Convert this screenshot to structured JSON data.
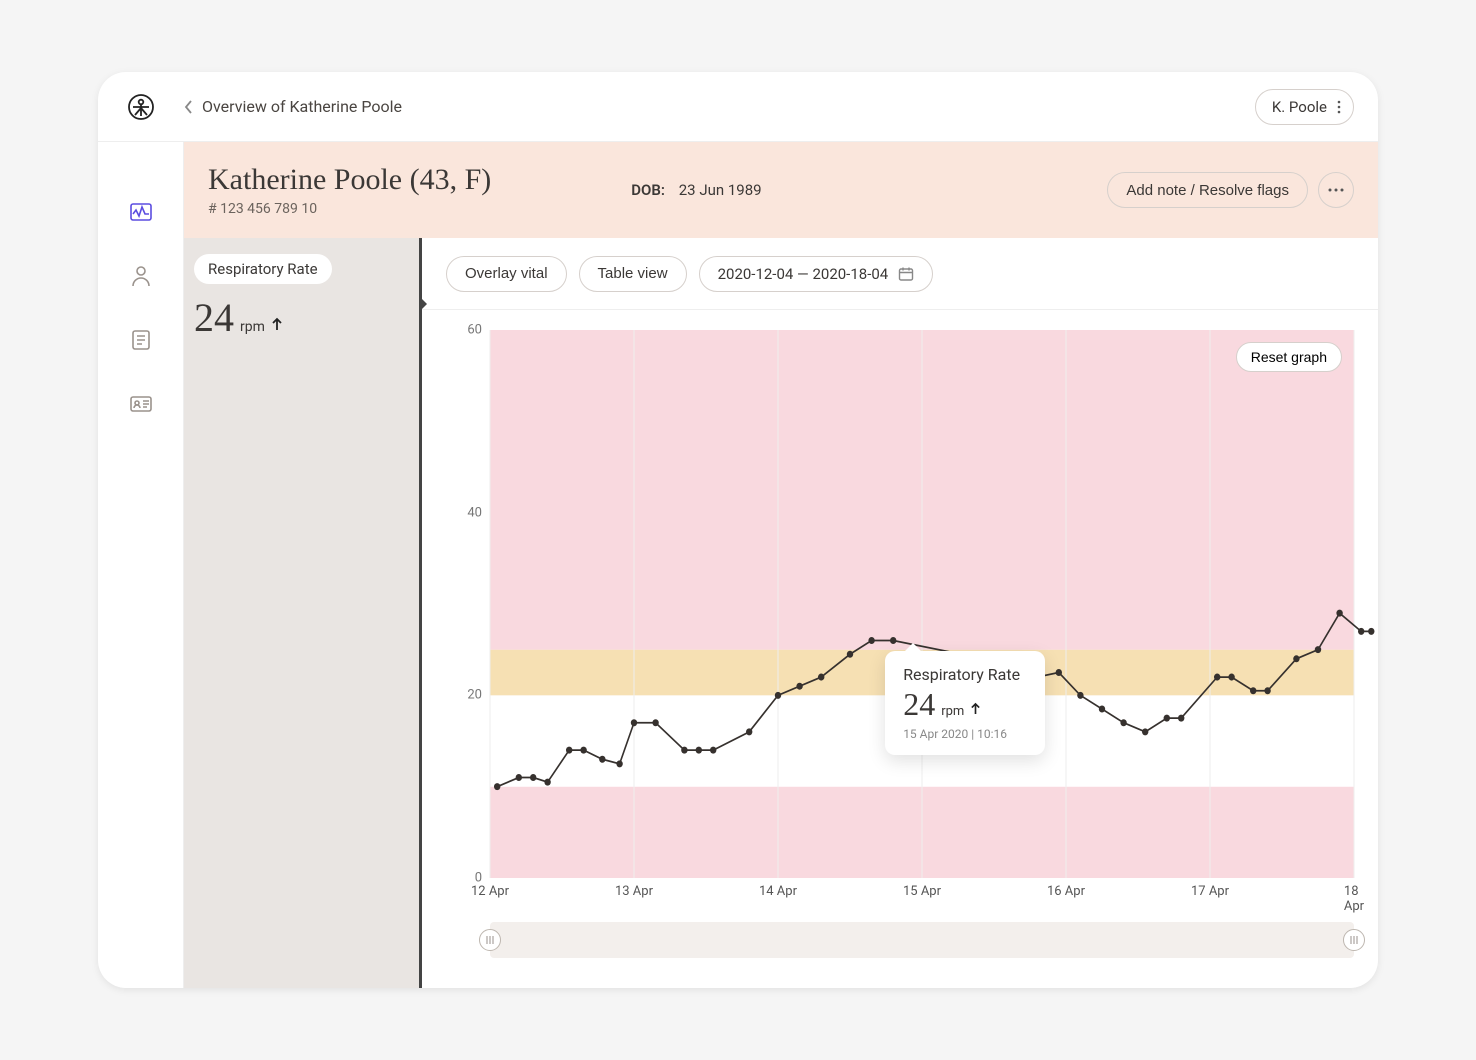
{
  "topbar": {
    "breadcrumb": "Overview of Katherine Poole",
    "user_label": "K. Poole"
  },
  "patient": {
    "display_name": "Katherine Poole (43,  F)",
    "record_id": "# 123 456 789 10",
    "dob_label": "DOB:",
    "dob_value": "23 Jun 1989",
    "add_note_label": "Add note / Resolve flags"
  },
  "vital_panel": {
    "chip": "Respiratory Rate",
    "value": "24",
    "unit": "rpm",
    "trend": "up"
  },
  "toolbar": {
    "overlay": "Overlay vital",
    "table": "Table view",
    "date_range": "2020-12-04 — 2020-18-04"
  },
  "chart": {
    "reset_label": "Reset graph"
  },
  "tooltip": {
    "title": "Respiratory Rate",
    "value": "24",
    "unit": "rpm",
    "timestamp": "15 Apr 2020 | 10:16"
  },
  "chart_data": {
    "type": "line",
    "title": "Respiratory Rate",
    "ylabel": "rpm",
    "ylim": [
      0,
      60
    ],
    "y_ticks": [
      0,
      20,
      40,
      60
    ],
    "x_ticks": [
      "12 Apr",
      "13 Apr",
      "14 Apr",
      "15 Apr",
      "16 Apr",
      "17 Apr",
      "18 Apr"
    ],
    "bands": [
      {
        "from": 0,
        "to": 10,
        "color": "#f9d9df",
        "meaning": "critical-low"
      },
      {
        "from": 10,
        "to": 20,
        "color": "#ffffff",
        "meaning": "normal"
      },
      {
        "from": 20,
        "to": 25,
        "color": "#f6e0b3",
        "meaning": "warning"
      },
      {
        "from": 25,
        "to": 60,
        "color": "#f9d9df",
        "meaning": "critical-high"
      }
    ],
    "series": [
      {
        "name": "Respiratory Rate",
        "unit": "rpm",
        "points": [
          {
            "x": 12.05,
            "y": 10
          },
          {
            "x": 12.2,
            "y": 11
          },
          {
            "x": 12.3,
            "y": 11
          },
          {
            "x": 12.4,
            "y": 10.5
          },
          {
            "x": 12.55,
            "y": 14
          },
          {
            "x": 12.65,
            "y": 14
          },
          {
            "x": 12.78,
            "y": 13
          },
          {
            "x": 12.9,
            "y": 12.5
          },
          {
            "x": 13.0,
            "y": 17
          },
          {
            "x": 13.15,
            "y": 17
          },
          {
            "x": 13.35,
            "y": 14
          },
          {
            "x": 13.45,
            "y": 14
          },
          {
            "x": 13.55,
            "y": 14
          },
          {
            "x": 13.8,
            "y": 16
          },
          {
            "x": 14.0,
            "y": 20
          },
          {
            "x": 14.15,
            "y": 21
          },
          {
            "x": 14.3,
            "y": 22
          },
          {
            "x": 14.5,
            "y": 24.5
          },
          {
            "x": 14.65,
            "y": 26
          },
          {
            "x": 14.8,
            "y": 26
          },
          {
            "x": 15.43,
            "y": 24
          },
          {
            "x": 15.55,
            "y": 21.5
          },
          {
            "x": 15.65,
            "y": 21.5
          },
          {
            "x": 15.8,
            "y": 22
          },
          {
            "x": 15.95,
            "y": 22.5
          },
          {
            "x": 16.1,
            "y": 20
          },
          {
            "x": 16.25,
            "y": 18.5
          },
          {
            "x": 16.4,
            "y": 17
          },
          {
            "x": 16.55,
            "y": 16
          },
          {
            "x": 16.7,
            "y": 17.5
          },
          {
            "x": 16.8,
            "y": 17.5
          },
          {
            "x": 17.05,
            "y": 22
          },
          {
            "x": 17.15,
            "y": 22
          },
          {
            "x": 17.3,
            "y": 20.5
          },
          {
            "x": 17.4,
            "y": 20.5
          },
          {
            "x": 17.6,
            "y": 24
          },
          {
            "x": 17.75,
            "y": 25
          },
          {
            "x": 17.9,
            "y": 29
          },
          {
            "x": 18.05,
            "y": 27
          },
          {
            "x": 18.12,
            "y": 27
          }
        ]
      }
    ],
    "tooltip_point": {
      "x": 14.8,
      "y": 26
    }
  }
}
